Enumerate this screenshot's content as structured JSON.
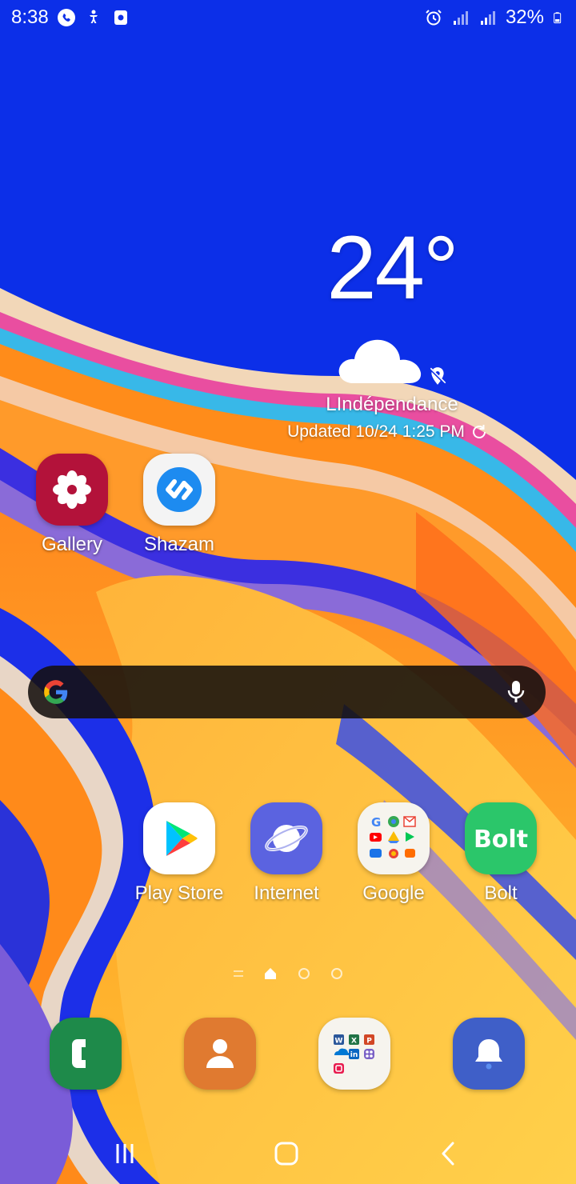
{
  "status_bar": {
    "time": "8:38",
    "battery": "32%",
    "left_icons": [
      "phone-call-icon",
      "accessibility-icon",
      "screen-recorder-icon"
    ],
    "right_icons": [
      "alarm-icon",
      "signal-icon",
      "signal-icon",
      "battery-icon"
    ]
  },
  "weather": {
    "temperature": "24°",
    "condition_icon": "cloud-icon",
    "location": "LIndépendance",
    "updated": "Updated 10/24 1:25 PM"
  },
  "apps_top": [
    {
      "label": "Gallery",
      "icon": "gallery-icon",
      "color": "#b3123a"
    },
    {
      "label": "Shazam",
      "icon": "shazam-icon",
      "color": "#1d8bf0"
    }
  ],
  "search": {
    "placeholder": "",
    "icon": "google-g-icon",
    "mic_icon": "mic-icon"
  },
  "apps_row": [
    {
      "label": "Play Store",
      "icon": "play-store-icon"
    },
    {
      "label": "Internet",
      "icon": "internet-icon",
      "color": "#5b63e0"
    },
    {
      "label": "Google",
      "icon": "google-folder-icon"
    },
    {
      "label": "Bolt",
      "icon": "bolt-icon",
      "color": "#2bc66a"
    }
  ],
  "page_indicator": {
    "pages": 3,
    "current": 1
  },
  "dock": [
    {
      "icon": "phone-icon",
      "color": "#1e8a4a"
    },
    {
      "icon": "contacts-icon",
      "color": "#e07a30"
    },
    {
      "icon": "microsoft-folder-icon"
    },
    {
      "icon": "notification-bell-icon",
      "color": "#3f5fc8"
    }
  ],
  "nav_bar": {
    "buttons": [
      "recents-button",
      "home-button",
      "back-button"
    ]
  }
}
